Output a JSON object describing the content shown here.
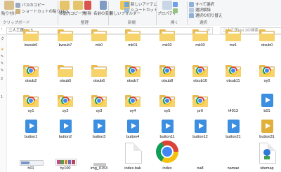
{
  "ribbon": {
    "paste_label": "貼り付け",
    "copy_path_label": "パスのコピー",
    "shortcut_paste_label": "ショートカットの貼り付け",
    "move_to_label": "移動先",
    "copy_to_label": "コピー先",
    "delete_label": "削除",
    "rename_label": "名前の変更",
    "new_folder_label": "新しいフォルダー",
    "new_item_label": "新しいアイテム",
    "shortcut_label": "ショートカット",
    "properties_label": "プロパティ",
    "select_all_label": "すべて選択",
    "select_none_label": "選択解除",
    "invert_selection_label": "選択の切り替え",
    "group_clipboard": "クリップボード",
    "group_organize": "整理",
    "group_new": "新規",
    "group_open": "開く",
    "group_select": "選択"
  },
  "address_bar": {
    "path": "二人工房kisi 3",
    "search_placeholder": "二人工房kisi 3の検索"
  },
  "nav_pane": {
    "visible_chars": [
      "ク",
      "3",
      "1"
    ]
  },
  "files": {
    "row1": [
      "kwsub6",
      "kwsub7",
      "mk0",
      "mk01",
      "mk02",
      "mk03",
      "mz1",
      "otsub0"
    ],
    "row2": [
      "otsub2",
      "otsub5",
      "otsub6",
      "otsub7",
      "otsub8",
      "otsub10",
      "otsub11",
      "oy0"
    ],
    "row3": [
      "oy1",
      "oy2",
      "oy3",
      "oy4",
      "oy5",
      "pr0",
      "t4013",
      "b01"
    ],
    "row4": [
      "button1",
      "button2",
      "button3",
      "button4",
      "button11",
      "button12",
      "button21",
      "button31"
    ],
    "row5": [
      "h01",
      "hy100",
      "img_0153",
      "index.bak",
      "index",
      "na8",
      "namae",
      "sitemap"
    ]
  },
  "colors": {
    "folder": "#e9b949",
    "media_blue": "#3b8ee0",
    "media_gold": "#e0b03b",
    "ribbon_bg": "#f5f6f7"
  }
}
